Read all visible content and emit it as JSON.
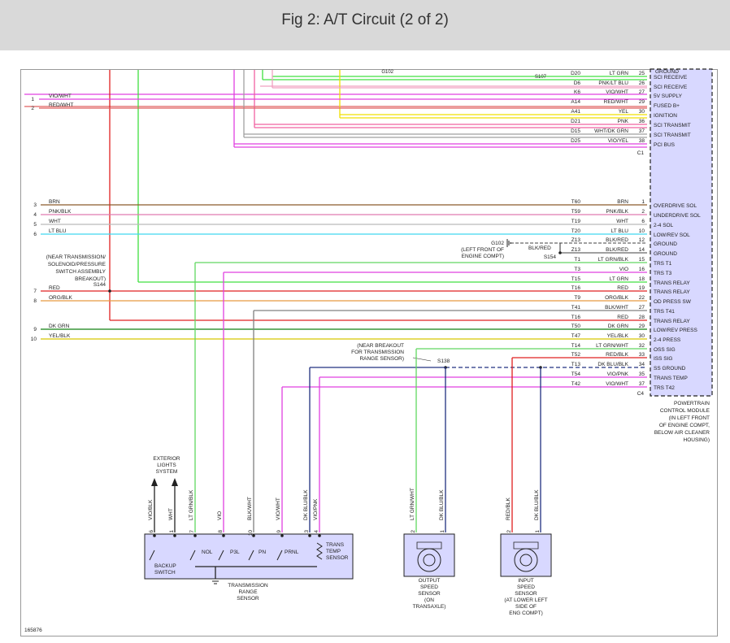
{
  "title": "Fig 2: A/T Circuit (2 of 2)",
  "figure_id": "165876",
  "colors": {
    "VIO/WHT": "#e040e0",
    "RED/WHT": "#e06060",
    "BRN": "#8b5a2b",
    "PNK/BLK": "#e07ab0",
    "WHT": "#bbbbbb",
    "LT BLU": "#40d8f0",
    "RED": "#e02020",
    "ORG/BLK": "#e89a40",
    "DK GRN": "#108010",
    "YEL/BLK": "#d8c800",
    "LT GRN": "#40e040",
    "YEL": "#f0e000",
    "PNK": "#f060a0",
    "WHT/DK GRN": "#a0a0a0",
    "VIO/YEL": "#e040e0",
    "LT GRN/WHT": "#60d860",
    "VIO": "#e040e0",
    "BLK/WHT": "#808080",
    "RED/BLK": "#e02020",
    "DK BLU/BLK": "#203080",
    "VIO/PNK": "#e040e0",
    "PNK/LT BLU": "#f0a0c0",
    "BLK/RED": "#404040"
  },
  "pcm": {
    "label_lines": [
      "POWERTRAIN",
      "CONTROL MODULE",
      "(IN LEFT FRONT",
      "OF ENGINE COMPT,",
      "BELOW AIR CLEANER",
      "HOUSING)"
    ],
    "c1_connector": "C1",
    "c4_connector": "C4",
    "top_partial": "GROUND",
    "top_splice": "G102",
    "top_splice2": "S107"
  },
  "c1_pins": [
    {
      "code": "D20",
      "wire": "LT GRN",
      "pin": "25",
      "func": "SCI RECEIVE"
    },
    {
      "code": "D6",
      "wire": "PNK/LT BLU",
      "pin": "26",
      "func": "SCI RECEIVE"
    },
    {
      "code": "K6",
      "wire": "VIO/WHT",
      "pin": "27",
      "func": "5V SUPPLY"
    },
    {
      "code": "A14",
      "wire": "RED/WHT",
      "pin": "29",
      "func": "FUSED B+"
    },
    {
      "code": "A41",
      "wire": "YEL",
      "pin": "30",
      "func": "IGNITION"
    },
    {
      "code": "D21",
      "wire": "PNK",
      "pin": "36",
      "func": "SCI TRANSMIT"
    },
    {
      "code": "D15",
      "wire": "WHT/DK GRN",
      "pin": "37",
      "func": "SCI TRANSMIT"
    },
    {
      "code": "D25",
      "wire": "VIO/YEL",
      "pin": "38",
      "func": "PCI BUS"
    }
  ],
  "c4_pins": [
    {
      "code": "T60",
      "wire": "BRN",
      "pin": "1",
      "func": "OVERDRIVE SOL"
    },
    {
      "code": "T59",
      "wire": "PNK/BLK",
      "pin": "2",
      "func": "UNDERDRIVE SOL"
    },
    {
      "code": "T19",
      "wire": "WHT",
      "pin": "6",
      "func": "2-4 SOL"
    },
    {
      "code": "T20",
      "wire": "LT BLU",
      "pin": "10",
      "func": "LOW/REV SOL"
    },
    {
      "code": "Z13",
      "wire": "BLK/RED",
      "pin": "12",
      "func": "GROUND"
    },
    {
      "code": "Z13",
      "wire": "BLK/RED",
      "pin": "14",
      "func": "GROUND"
    },
    {
      "code": "T1",
      "wire": "LT GRN/BLK",
      "pin": "15",
      "func": "TRS T1"
    },
    {
      "code": "T3",
      "wire": "VIO",
      "pin": "16",
      "func": "TRS T3"
    },
    {
      "code": "T15",
      "wire": "LT GRN",
      "pin": "18",
      "func": "TRANS RELAY"
    },
    {
      "code": "T16",
      "wire": "RED",
      "pin": "19",
      "func": "TRANS RELAY"
    },
    {
      "code": "T9",
      "wire": "ORG/BLK",
      "pin": "22",
      "func": "OD PRESS SW"
    },
    {
      "code": "T41",
      "wire": "BLK/WHT",
      "pin": "27",
      "func": "TRS T41"
    },
    {
      "code": "T16",
      "wire": "RED",
      "pin": "28",
      "func": "TRANS RELAY"
    },
    {
      "code": "T50",
      "wire": "DK GRN",
      "pin": "29",
      "func": "LOW/REV PRESS"
    },
    {
      "code": "T47",
      "wire": "YEL/BLK",
      "pin": "30",
      "func": "2-4 PRESS"
    },
    {
      "code": "T14",
      "wire": "LT GRN/WHT",
      "pin": "32",
      "func": "OSS SIG"
    },
    {
      "code": "T52",
      "wire": "RED/BLK",
      "pin": "33",
      "func": "ISS SIG"
    },
    {
      "code": "T13",
      "wire": "DK BLU/BLK",
      "pin": "34",
      "func": "SS GROUND"
    },
    {
      "code": "T54",
      "wire": "VIO/PNK",
      "pin": "35",
      "func": "TRANS TEMP"
    },
    {
      "code": "T42",
      "wire": "VIO/WHT",
      "pin": "37",
      "func": "TRS T42"
    }
  ],
  "left_wires_top": [
    {
      "num": "1",
      "wire": "VIO/WHT"
    },
    {
      "num": "2",
      "wire": "RED/WHT"
    }
  ],
  "left_wires_bottom": [
    {
      "num": "3",
      "wire": "BRN"
    },
    {
      "num": "4",
      "wire": "PNK/BLK"
    },
    {
      "num": "5",
      "wire": "WHT"
    },
    {
      "num": "6",
      "wire": "LT BLU"
    },
    {
      "num": "7",
      "wire": "RED"
    },
    {
      "num": "8",
      "wire": "ORG/BLK"
    },
    {
      "num": "9",
      "wire": "DK GRN"
    },
    {
      "num": "10",
      "wire": "YEL/BLK"
    }
  ],
  "splices": {
    "g102": "G102",
    "g102_note": [
      "(LEFT FRONT OF",
      "ENGINE COMPT)"
    ],
    "s154": "S154",
    "s144": "S144",
    "s144_note": [
      "(NEAR TRANSMISSION/",
      "SOLENOID/PRESSURE",
      "SWITCH ASSEMBLY",
      "BREAKOUT)"
    ],
    "s138": "S138",
    "s138_note": [
      "(NEAR BREAKOUT",
      "FOR TRANSMISSION",
      "RANGE SENSOR)"
    ],
    "blk_red": "BLK/RED"
  },
  "trs": {
    "label": [
      "TRANSMISSION",
      "RANGE",
      "SENSOR"
    ],
    "backup_switch": [
      "BACKUP",
      "SWITCH"
    ],
    "exterior_lights": [
      "EXTERIOR",
      "LIGHTS",
      "SYSTEM"
    ],
    "positions": [
      "NOL",
      "P3L",
      "PN",
      "PRNL"
    ],
    "trans_temp": [
      "TRANS",
      "TEMP",
      "SENSOR"
    ],
    "wires": [
      {
        "pin": "6",
        "wire": "VIO/BLK"
      },
      {
        "pin": "1",
        "wire": "WHT"
      },
      {
        "pin": "7",
        "wire": "LT GRN/BLK"
      },
      {
        "pin": "8",
        "wire": "VIO"
      },
      {
        "pin": "10",
        "wire": "BLK/WHT"
      },
      {
        "pin": "9",
        "wire": "VIO/WHT"
      },
      {
        "pin": "3",
        "wire": "DK BLU/BLK"
      },
      {
        "pin": "4",
        "wire": "VIO/PNK"
      }
    ]
  },
  "oss": {
    "label": [
      "OUTPUT",
      "SPEED",
      "SENSOR",
      "(ON",
      "TRANSAXLE)"
    ],
    "wires": [
      {
        "pin": "2",
        "wire": "LT GRN/WHT"
      },
      {
        "pin": "1",
        "wire": "DK BLU/BLK"
      }
    ]
  },
  "iss": {
    "label": [
      "INPUT",
      "SPEED",
      "SENSOR",
      "(AT LOWER LEFT",
      "SIDE OF",
      "ENG COMPT)"
    ],
    "wires": [
      {
        "pin": "2",
        "wire": "RED/BLK"
      },
      {
        "pin": "1",
        "wire": "DK BLU/BLK"
      }
    ]
  }
}
